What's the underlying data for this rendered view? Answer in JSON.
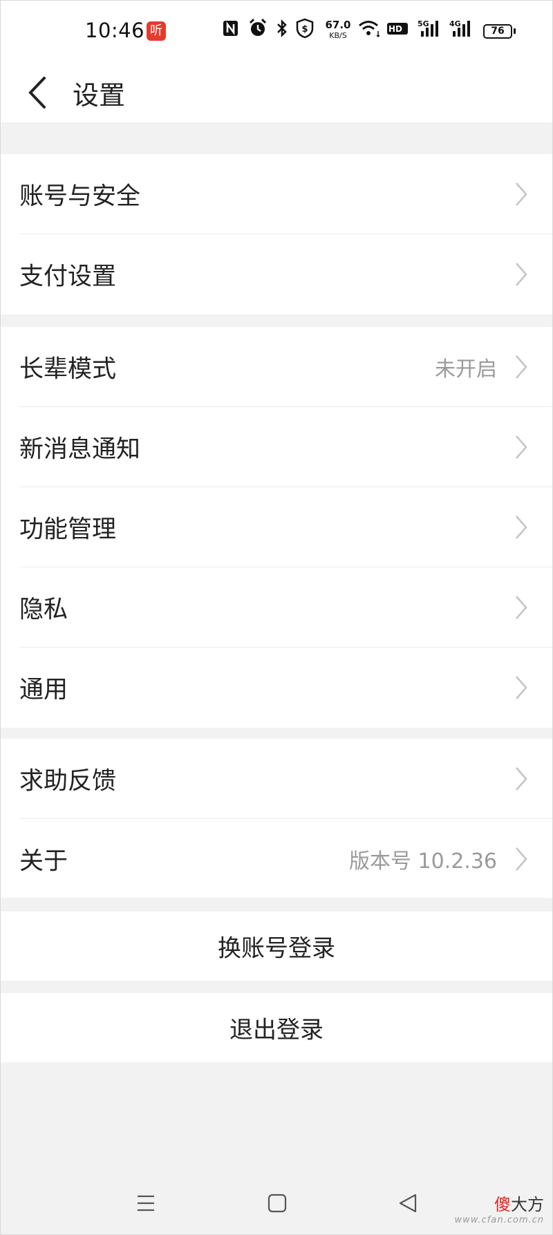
{
  "status_bar": {
    "time": "10:46",
    "app_badge": "听",
    "net_speed_value": "67.0",
    "net_speed_unit": "KB/S",
    "battery": "76",
    "icons": [
      "nfc-icon",
      "alarm-icon",
      "bluetooth-icon",
      "shield-icon",
      "wifi-icon",
      "hd-icon",
      "signal-5g-icon",
      "signal-4g-icon",
      "battery-icon"
    ]
  },
  "header": {
    "title": "设置"
  },
  "groups": [
    {
      "items": [
        {
          "label": "账号与安全",
          "value": ""
        },
        {
          "label": "支付设置",
          "value": ""
        }
      ]
    },
    {
      "items": [
        {
          "label": "长辈模式",
          "value": "未开启"
        },
        {
          "label": "新消息通知",
          "value": ""
        },
        {
          "label": "功能管理",
          "value": ""
        },
        {
          "label": "隐私",
          "value": ""
        },
        {
          "label": "通用",
          "value": ""
        }
      ]
    },
    {
      "items": [
        {
          "label": "求助反馈",
          "value": ""
        },
        {
          "label": "关于",
          "value": "版本号 10.2.36"
        }
      ]
    }
  ],
  "actions": {
    "switch_account": "换账号登录",
    "logout": "退出登录"
  },
  "watermark": {
    "accent_char": "傻",
    "rest": "大方",
    "sub": "www.cfan.com.cn"
  },
  "colors": {
    "background": "#f2f2f2",
    "card": "#ffffff",
    "text": "#222222",
    "secondary_text": "#9a9a9a",
    "badge_red": "#e53b2c"
  }
}
